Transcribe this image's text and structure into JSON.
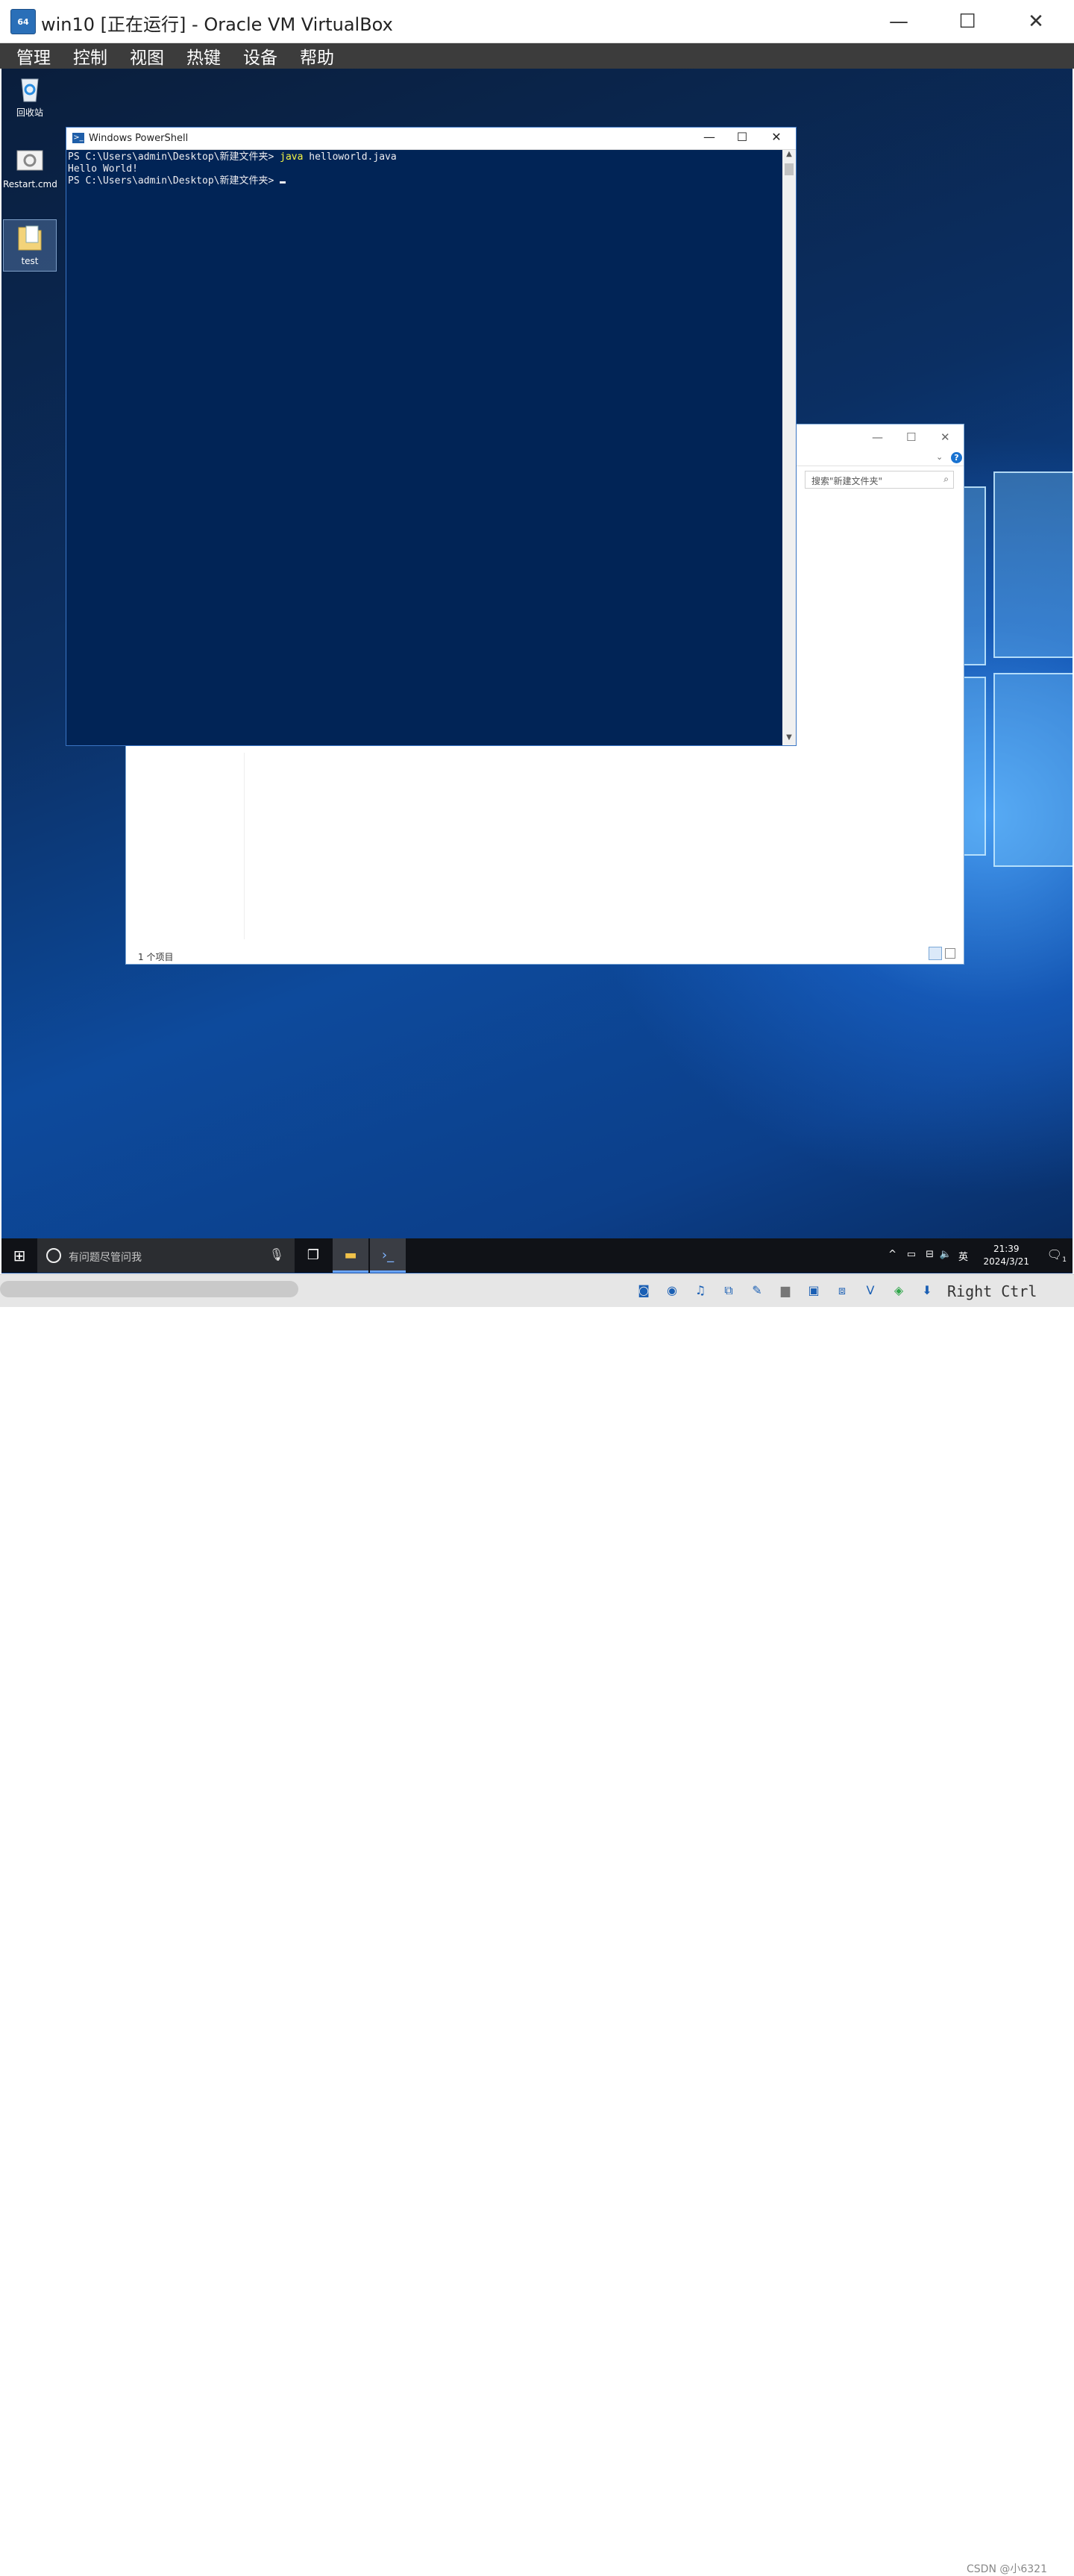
{
  "host": {
    "title": "win10 [正在运行] - Oracle VM VirtualBox",
    "app_icon_label": "64 10",
    "menu": [
      "管理",
      "控制",
      "视图",
      "热键",
      "设备",
      "帮助"
    ],
    "controls": {
      "minimize": "—",
      "maximize": "☐",
      "close": "✕"
    },
    "host_key": "Right Ctrl",
    "watermark": "CSDN @小6321"
  },
  "desktop": {
    "icons": [
      {
        "label": "回收站",
        "icon": "recycle-bin-icon"
      },
      {
        "label": "Restart.cmd",
        "icon": "cmd-script-icon"
      },
      {
        "label": "test",
        "icon": "text-file-icon"
      }
    ]
  },
  "explorer": {
    "search_placeholder": "搜索\"新建文件夹\"",
    "status": "1 个项目",
    "help_label": "?"
  },
  "powershell": {
    "title": "Windows PowerShell",
    "lines": [
      {
        "prompt": "PS C:\\Users\\admin\\Desktop\\新建文件夹> ",
        "command": "java",
        "args": " helloworld.java"
      },
      {
        "output": "Hello World!"
      },
      {
        "prompt": "PS C:\\Users\\admin\\Desktop\\新建文件夹> "
      }
    ]
  },
  "taskbar": {
    "search_placeholder": "有问题尽管问我",
    "ime": "英",
    "time": "21:39",
    "date": "2024/3/21",
    "notification_count": "1"
  }
}
